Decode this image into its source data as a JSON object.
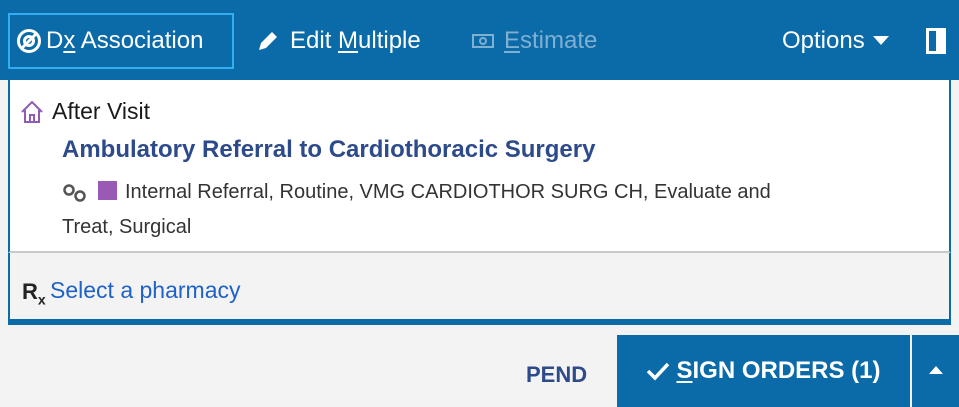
{
  "toolbar": {
    "dx_prefix": "D",
    "dx_underlined": "x",
    "dx_suffix": " Association",
    "edit_prefix": "Edit ",
    "edit_underlined": "M",
    "edit_suffix": "ultiple",
    "estimate_underlined": "E",
    "estimate_suffix": "stimate",
    "options_label": "Options"
  },
  "section": {
    "title": "After Visit"
  },
  "order": {
    "name": "Ambulatory Referral to Cardiothoracic Surgery",
    "detail": "Internal Referral, Routine, VMG CARDIOTHOR SURG CH, Evaluate and Treat, Surgical",
    "swatch_color": "#9b59b6"
  },
  "pharmacy": {
    "rx_symbol": "R",
    "rx_sub": "x",
    "link": "Select a pharmacy"
  },
  "footer": {
    "pend_label": "PEND",
    "sign_underlined": "S",
    "sign_suffix": "IGN ORDERS (1)"
  },
  "colors": {
    "toolbar": "#0b6aa8",
    "link": "#1e62c8",
    "order_name": "#2d4a8a"
  }
}
